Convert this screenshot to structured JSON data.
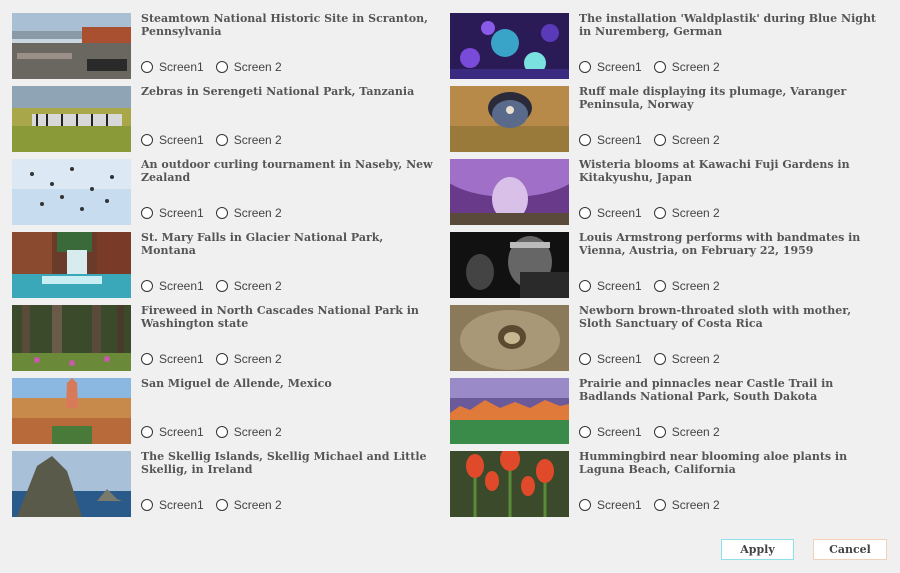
{
  "radio_labels": {
    "screen1": "Screen1",
    "screen2": "Screen 2"
  },
  "buttons": {
    "apply": "Apply",
    "cancel": "Cancel"
  },
  "items": [
    {
      "caption": "Steamtown National Historic Site in Scranton, Pennsylvania",
      "thumb": "steamtown"
    },
    {
      "caption": "The installation 'Waldplastik' during Blue Night in Nuremberg, German",
      "thumb": "waldplastik"
    },
    {
      "caption": "Zebras in Serengeti National Park, Tanzania",
      "thumb": "zebras"
    },
    {
      "caption": "Ruff male displaying its plumage, Varanger Peninsula, Norway",
      "thumb": "ruff"
    },
    {
      "caption": "An outdoor curling tournament in Naseby, New Zealand",
      "thumb": "curling"
    },
    {
      "caption": "Wisteria blooms at Kawachi Fuji Gardens in Kitakyushu, Japan",
      "thumb": "wisteria"
    },
    {
      "caption": "St. Mary Falls in Glacier National Park, Montana",
      "thumb": "falls"
    },
    {
      "caption": "Louis Armstrong performs with bandmates in Vienna, Austria, on February 22, 1959",
      "thumb": "armstrong"
    },
    {
      "caption": "Fireweed in North Cascades National Park in Washington state",
      "thumb": "fireweed"
    },
    {
      "caption": "Newborn brown-throated sloth with mother, Sloth Sanctuary of Costa Rica",
      "thumb": "sloth"
    },
    {
      "caption": "San Miguel de Allende, Mexico",
      "thumb": "sanmiguel"
    },
    {
      "caption": "Prairie and pinnacles near Castle Trail in Badlands National Park, South Dakota",
      "thumb": "badlands"
    },
    {
      "caption": "The Skellig Islands, Skellig Michael and Little Skellig, in Ireland",
      "thumb": "skellig"
    },
    {
      "caption": "Hummingbird near blooming aloe plants in Laguna Beach, California",
      "thumb": "aloe"
    }
  ]
}
